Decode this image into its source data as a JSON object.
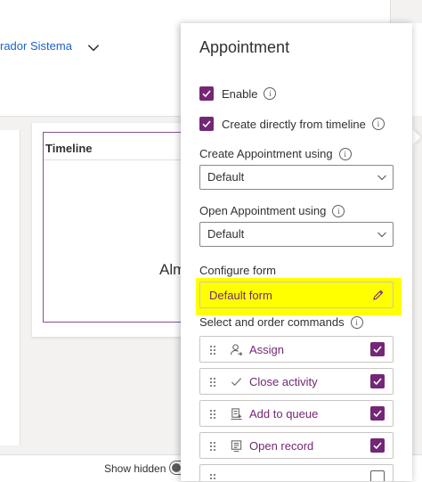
{
  "background": {
    "record_name": "rador Sistema",
    "timeline_title": "Timeline",
    "timeline_partial": "Alm",
    "show_hidden": "Show hidden"
  },
  "pane": {
    "title": "Appointment",
    "enable_label": "Enable",
    "enable_checked": true,
    "create_from_timeline_label": "Create directly from timeline",
    "create_from_timeline_checked": true,
    "create_using_label": "Create Appointment using",
    "create_using_value": "Default",
    "open_using_label": "Open Appointment using",
    "open_using_value": "Default",
    "configure_form_label": "Configure form",
    "default_form_label": "Default form",
    "commands_label": "Select and order commands",
    "commands": [
      {
        "label": "Assign",
        "icon": "assign-icon",
        "checked": true
      },
      {
        "label": "Close activity",
        "icon": "checkmark-icon",
        "checked": true
      },
      {
        "label": "Add to queue",
        "icon": "queue-icon",
        "checked": true
      },
      {
        "label": "Open record",
        "icon": "form-icon",
        "checked": true
      }
    ]
  },
  "colors": {
    "accent": "#742774",
    "link": "#1b63c9",
    "highlight": "#ffff00"
  }
}
